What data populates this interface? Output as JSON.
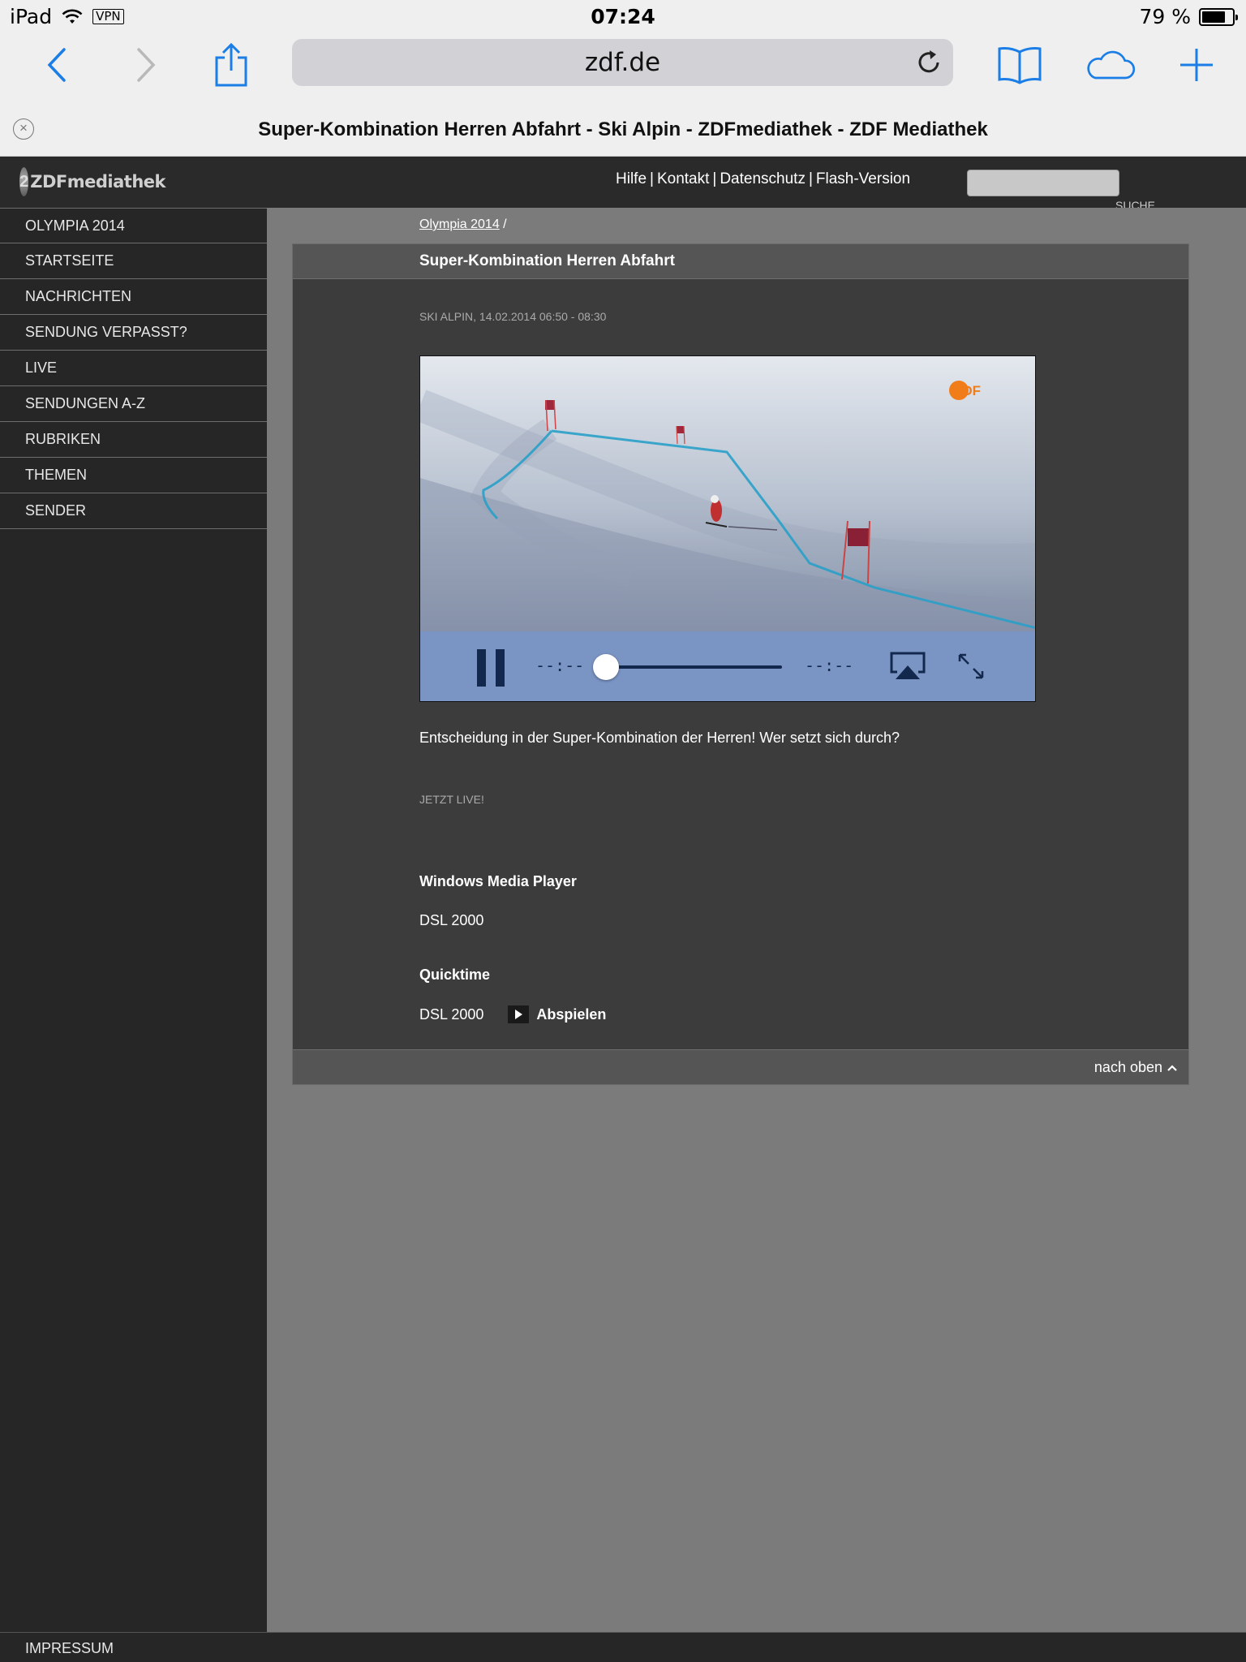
{
  "status_bar": {
    "device": "iPad",
    "vpn": "VPN",
    "time": "07:24",
    "battery": "79 %",
    "battery_level": 0.79
  },
  "browser": {
    "url": "zdf.de",
    "tab_title": "Super-Kombination Herren Abfahrt - Ski Alpin - ZDFmediathek - ZDF Mediathek",
    "icons": {
      "back": "chevron-left-icon",
      "forward": "chevron-right-icon",
      "share": "share-icon",
      "reload": "reload-icon",
      "bookmarks": "book-icon",
      "icloud": "cloud-icon",
      "new_tab": "plus-icon",
      "close_tab": "close-icon"
    },
    "accent_color": "#1a7ee6"
  },
  "site": {
    "logo": "ZDFmediathek",
    "top_links": [
      "Hilfe",
      "Kontakt",
      "Datenschutz",
      "Flash-Version"
    ],
    "search_label": "SUCHE"
  },
  "sidebar": {
    "items": [
      {
        "label": "OLYMPIA 2014"
      },
      {
        "label": "STARTSEITE"
      },
      {
        "label": "NACHRICHTEN"
      },
      {
        "label": "SENDUNG VERPASST?"
      },
      {
        "label": "LIVE"
      },
      {
        "label": "SENDUNGEN A-Z"
      },
      {
        "label": "RUBRIKEN"
      },
      {
        "label": "THEMEN"
      },
      {
        "label": "SENDER"
      }
    ]
  },
  "breadcrumb": {
    "link": "Olympia 2014",
    "separator": "/"
  },
  "article": {
    "title": "Super-Kombination Herren Abfahrt",
    "meta": "SKI ALPIN, 14.02.2014 06:50 - 08:30",
    "description": "Entscheidung in der Super-Kombination der Herren! Wer setzt sich durch?",
    "live_label": "JETZT LIVE!",
    "wmp_heading": "Windows Media Player",
    "wmp_quality": "DSL 2000",
    "qt_heading": "Quicktime",
    "qt_quality": "DSL 2000",
    "play_label": "Abspielen",
    "back_to_top": "nach oben"
  },
  "player": {
    "elapsed": "--:--",
    "remaining": "--:--",
    "watermark": "ZDF",
    "watermark_color": "#f07d1a",
    "controls_color": "#7a94c4",
    "progress": 0
  }
}
